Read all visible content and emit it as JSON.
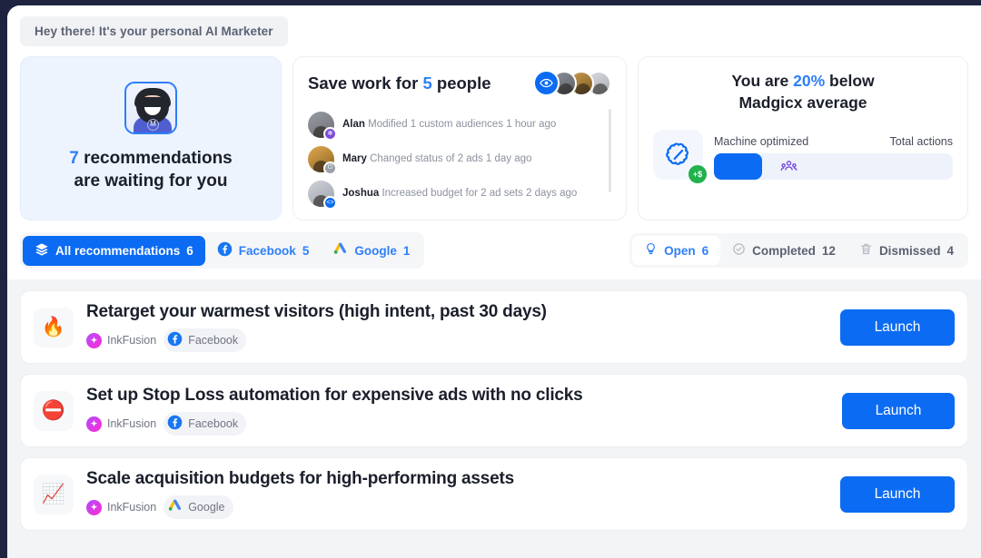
{
  "greeting": "Hey there! It's your personal AI Marketer",
  "recommendations_card": {
    "count": "7",
    "line1_rest": " recommendations",
    "line2": "are waiting for you",
    "mascot_letter": "M"
  },
  "save_work_card": {
    "title_pre": "Save work for ",
    "title_num": "5",
    "title_post": " people",
    "eye_icon": "eye-icon",
    "activities": [
      {
        "name": "Alan",
        "text": "Modified 1 custom audiences 1 hour ago",
        "badge": "atom-icon"
      },
      {
        "name": "Mary",
        "text": "Changed status of 2 ads 1 day ago",
        "badge": "power-icon"
      },
      {
        "name": "Joshua",
        "text": "Increased budget for 2 ad sets 2 days ago",
        "badge": "code-icon"
      }
    ]
  },
  "stats_card": {
    "title_pre": "You are ",
    "title_num": "20%",
    "title_post": " below",
    "title_line2": "Madgicx average",
    "brain_icon": "brain-icon",
    "money_badge": "+$",
    "label_left": "Machine optimized",
    "label_right": "Total actions",
    "progress_percent": 20
  },
  "source_filters": [
    {
      "label": "All recommendations",
      "count": "6",
      "icon": "layers-icon",
      "active": true
    },
    {
      "label": "Facebook",
      "count": "5",
      "icon": "facebook-icon",
      "active": false
    },
    {
      "label": "Google",
      "count": "1",
      "icon": "google-ads-icon",
      "active": false
    }
  ],
  "status_filters": [
    {
      "label": "Open",
      "count": "6",
      "icon": "lightbulb-icon",
      "active": true
    },
    {
      "label": "Completed",
      "count": "12",
      "icon": "check-circle-icon",
      "active": false
    },
    {
      "label": "Dismissed",
      "count": "4",
      "icon": "trash-icon",
      "active": false
    }
  ],
  "recommendations": [
    {
      "icon": "fire-emoji",
      "title": "Retarget your warmest visitors (high intent, past 30 days)",
      "brand": "InkFusion",
      "platform": "Facebook",
      "platform_icon": "facebook-icon",
      "button": "Launch"
    },
    {
      "icon": "no-entry-emoji",
      "title": "Set up Stop Loss automation for expensive ads with no clicks",
      "brand": "InkFusion",
      "platform": "Facebook",
      "platform_icon": "facebook-icon",
      "button": "Launch"
    },
    {
      "icon": "chart-increasing-emoji",
      "title": "Scale acquisition budgets for high-performing assets",
      "brand": "InkFusion",
      "platform": "Google",
      "platform_icon": "google-ads-icon",
      "button": "Launch"
    }
  ],
  "colors": {
    "accent_blue": "#0b6bf2",
    "link_blue": "#2d7ff9",
    "frame_navy": "#1e2340",
    "page_bg": "#f3f4f6",
    "green": "#22b14c"
  }
}
